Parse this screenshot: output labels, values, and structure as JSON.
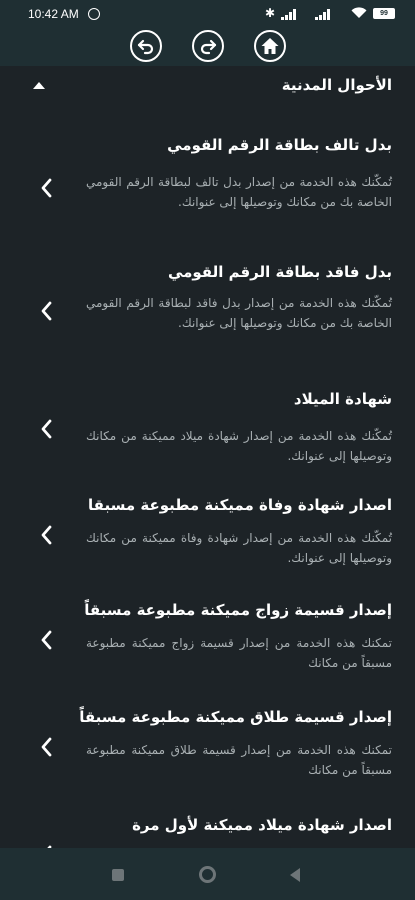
{
  "status_bar": {
    "time": "10:42 AM",
    "battery": "99",
    "icons": [
      "alarm-icon",
      "bluetooth-icon",
      "signal-icon",
      "signal-icon",
      "wifi-icon",
      "battery-icon"
    ]
  },
  "toolbar": {
    "buttons": [
      "back-icon",
      "forward-icon",
      "home-icon"
    ]
  },
  "section": {
    "title": "الأحوال المدنية",
    "expanded": true
  },
  "services": [
    {
      "title": "بدل تالف بطاقة الرقم القومي",
      "description": "تُمكّنك هذه الخدمة من إصدار بدل تالف لبطاقة الرقم القومي الخاصة بك من مكانك وتوصيلها إلى عنوانك."
    },
    {
      "title": "بدل فاقد بطاقة الرقم القومي",
      "description": "تُمكّنك هذه الخدمة من إصدار بدل فاقد لبطاقة الرقم القومي الخاصة بك من مكانك وتوصيلها إلى عنوانك."
    },
    {
      "title": "شهادة الميلاد",
      "description": "تُمكّنك هذه الخدمة من إصدار شهادة ميلاد مميكنة من مكانك وتوصيلها إلى عنوانك."
    },
    {
      "title": "اصدار شهادة وفاة مميكنة مطبوعة مسبقا",
      "description": "تُمكّنك هذه الخدمة من إصدار شهادة وفاة مميكنة من مكانك وتوصيلها إلى عنوانك."
    },
    {
      "title": "إصدار قسيمة زواج مميكنة مطبوعة مسبقاً",
      "description": "تمكنك هذه الخدمة من إصدار قسيمة زواج مميكنة مطبوعة مسبقاً من مكانك"
    },
    {
      "title": "إصدار قسيمة طلاق مميكنة مطبوعة مسبقاً",
      "description": "تمكنك هذه الخدمة من إصدار قسيمة طلاق مميكنة مطبوعة مسبقاً من مكانك"
    },
    {
      "title": "اصدار شهادة ميلاد مميكنة لأول مرة",
      "description": ""
    }
  ],
  "system_nav": [
    "recents-icon",
    "home-circle-icon",
    "back-triangle-icon"
  ],
  "colors": {
    "background": "#1d2327",
    "bars": "#1f2f33",
    "title_text": "#ffffff",
    "desc_text": "#a9b0b3"
  }
}
